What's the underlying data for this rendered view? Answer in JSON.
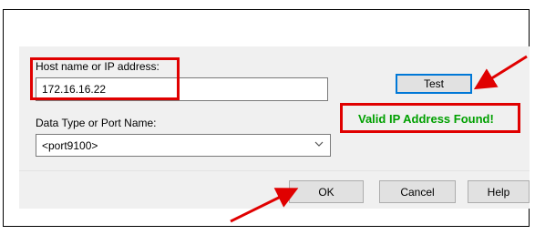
{
  "dialog": {
    "host_label": "Host name or IP address:",
    "host_value": "172.16.16.22",
    "data_type_label": "Data Type or Port Name:",
    "data_type_value": "<port9100>",
    "test_button": "Test",
    "status_message": "Valid IP Address Found!",
    "ok_button": "OK",
    "cancel_button": "Cancel",
    "help_button": "Help"
  },
  "colors": {
    "highlight": "#e00000",
    "status_text": "#00a000",
    "focus_border": "#0078d7"
  },
  "icons": {
    "dropdown": "chevron-down-icon",
    "annotation": "red-arrow-icon"
  }
}
